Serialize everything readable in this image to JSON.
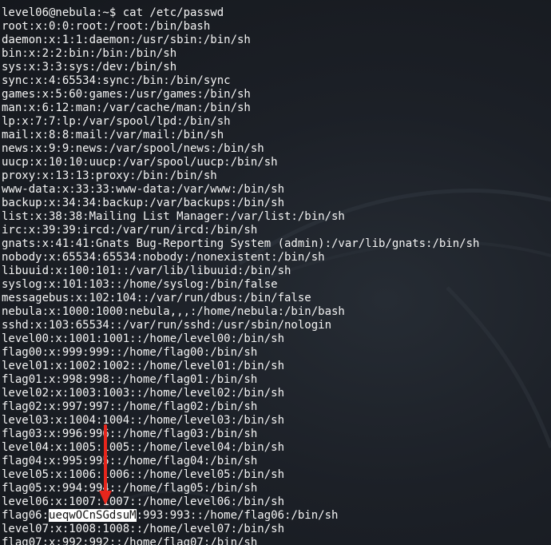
{
  "terminal": {
    "prompt_line": "level06@nebula:~$ cat /etc/passwd",
    "lines": [
      "root:x:0:0:root:/root:/bin/bash",
      "daemon:x:1:1:daemon:/usr/sbin:/bin/sh",
      "bin:x:2:2:bin:/bin:/bin/sh",
      "sys:x:3:3:sys:/dev:/bin/sh",
      "sync:x:4:65534:sync:/bin:/bin/sync",
      "games:x:5:60:games:/usr/games:/bin/sh",
      "man:x:6:12:man:/var/cache/man:/bin/sh",
      "lp:x:7:7:lp:/var/spool/lpd:/bin/sh",
      "mail:x:8:8:mail:/var/mail:/bin/sh",
      "news:x:9:9:news:/var/spool/news:/bin/sh",
      "uucp:x:10:10:uucp:/var/spool/uucp:/bin/sh",
      "proxy:x:13:13:proxy:/bin:/bin/sh",
      "www-data:x:33:33:www-data:/var/www:/bin/sh",
      "backup:x:34:34:backup:/var/backups:/bin/sh",
      "list:x:38:38:Mailing List Manager:/var/list:/bin/sh",
      "irc:x:39:39:ircd:/var/run/ircd:/bin/sh",
      "gnats:x:41:41:Gnats Bug-Reporting System (admin):/var/lib/gnats:/bin/sh",
      "nobody:x:65534:65534:nobody:/nonexistent:/bin/sh",
      "libuuid:x:100:101::/var/lib/libuuid:/bin/sh",
      "syslog:x:101:103::/home/syslog:/bin/false",
      "messagebus:x:102:104::/var/run/dbus:/bin/false",
      "nebula:x:1000:1000:nebula,,,:/home/nebula:/bin/bash",
      "sshd:x:103:65534::/var/run/sshd:/usr/sbin/nologin",
      "level00:x:1001:1001::/home/level00:/bin/sh",
      "flag00:x:999:999::/home/flag00:/bin/sh",
      "level01:x:1002:1002::/home/level01:/bin/sh",
      "flag01:x:998:998::/home/flag01:/bin/sh",
      "level02:x:1003:1003::/home/level02:/bin/sh",
      "flag02:x:997:997::/home/flag02:/bin/sh",
      "level03:x:1004:1004::/home/level03:/bin/sh",
      "flag03:x:996:996::/home/flag03:/bin/sh",
      "level04:x:1005:1005::/home/level04:/bin/sh",
      "flag04:x:995:995::/home/flag04:/bin/sh",
      "level05:x:1006:1006::/home/level05:/bin/sh",
      "flag05:x:994:994::/home/flag05:/bin/sh",
      "level06:x:1007:1007::/home/level06:/bin/sh"
    ],
    "highlight_line": {
      "prefix": "flag06:",
      "highlighted": "ueqwOCnSGdsuM",
      "suffix": ":993:993::/home/flag06:/bin/sh"
    },
    "lines_after": [
      "level07:x:1008:1008::/home/level07:/bin/sh",
      "flag07:x:992:992::/home/flag07:/bin/sh"
    ]
  },
  "colors": {
    "background": "#1c2027",
    "text": "#f4f4f4",
    "highlight_bg": "#ffffff",
    "highlight_text": "#111111",
    "arrow": "#e8261c"
  }
}
